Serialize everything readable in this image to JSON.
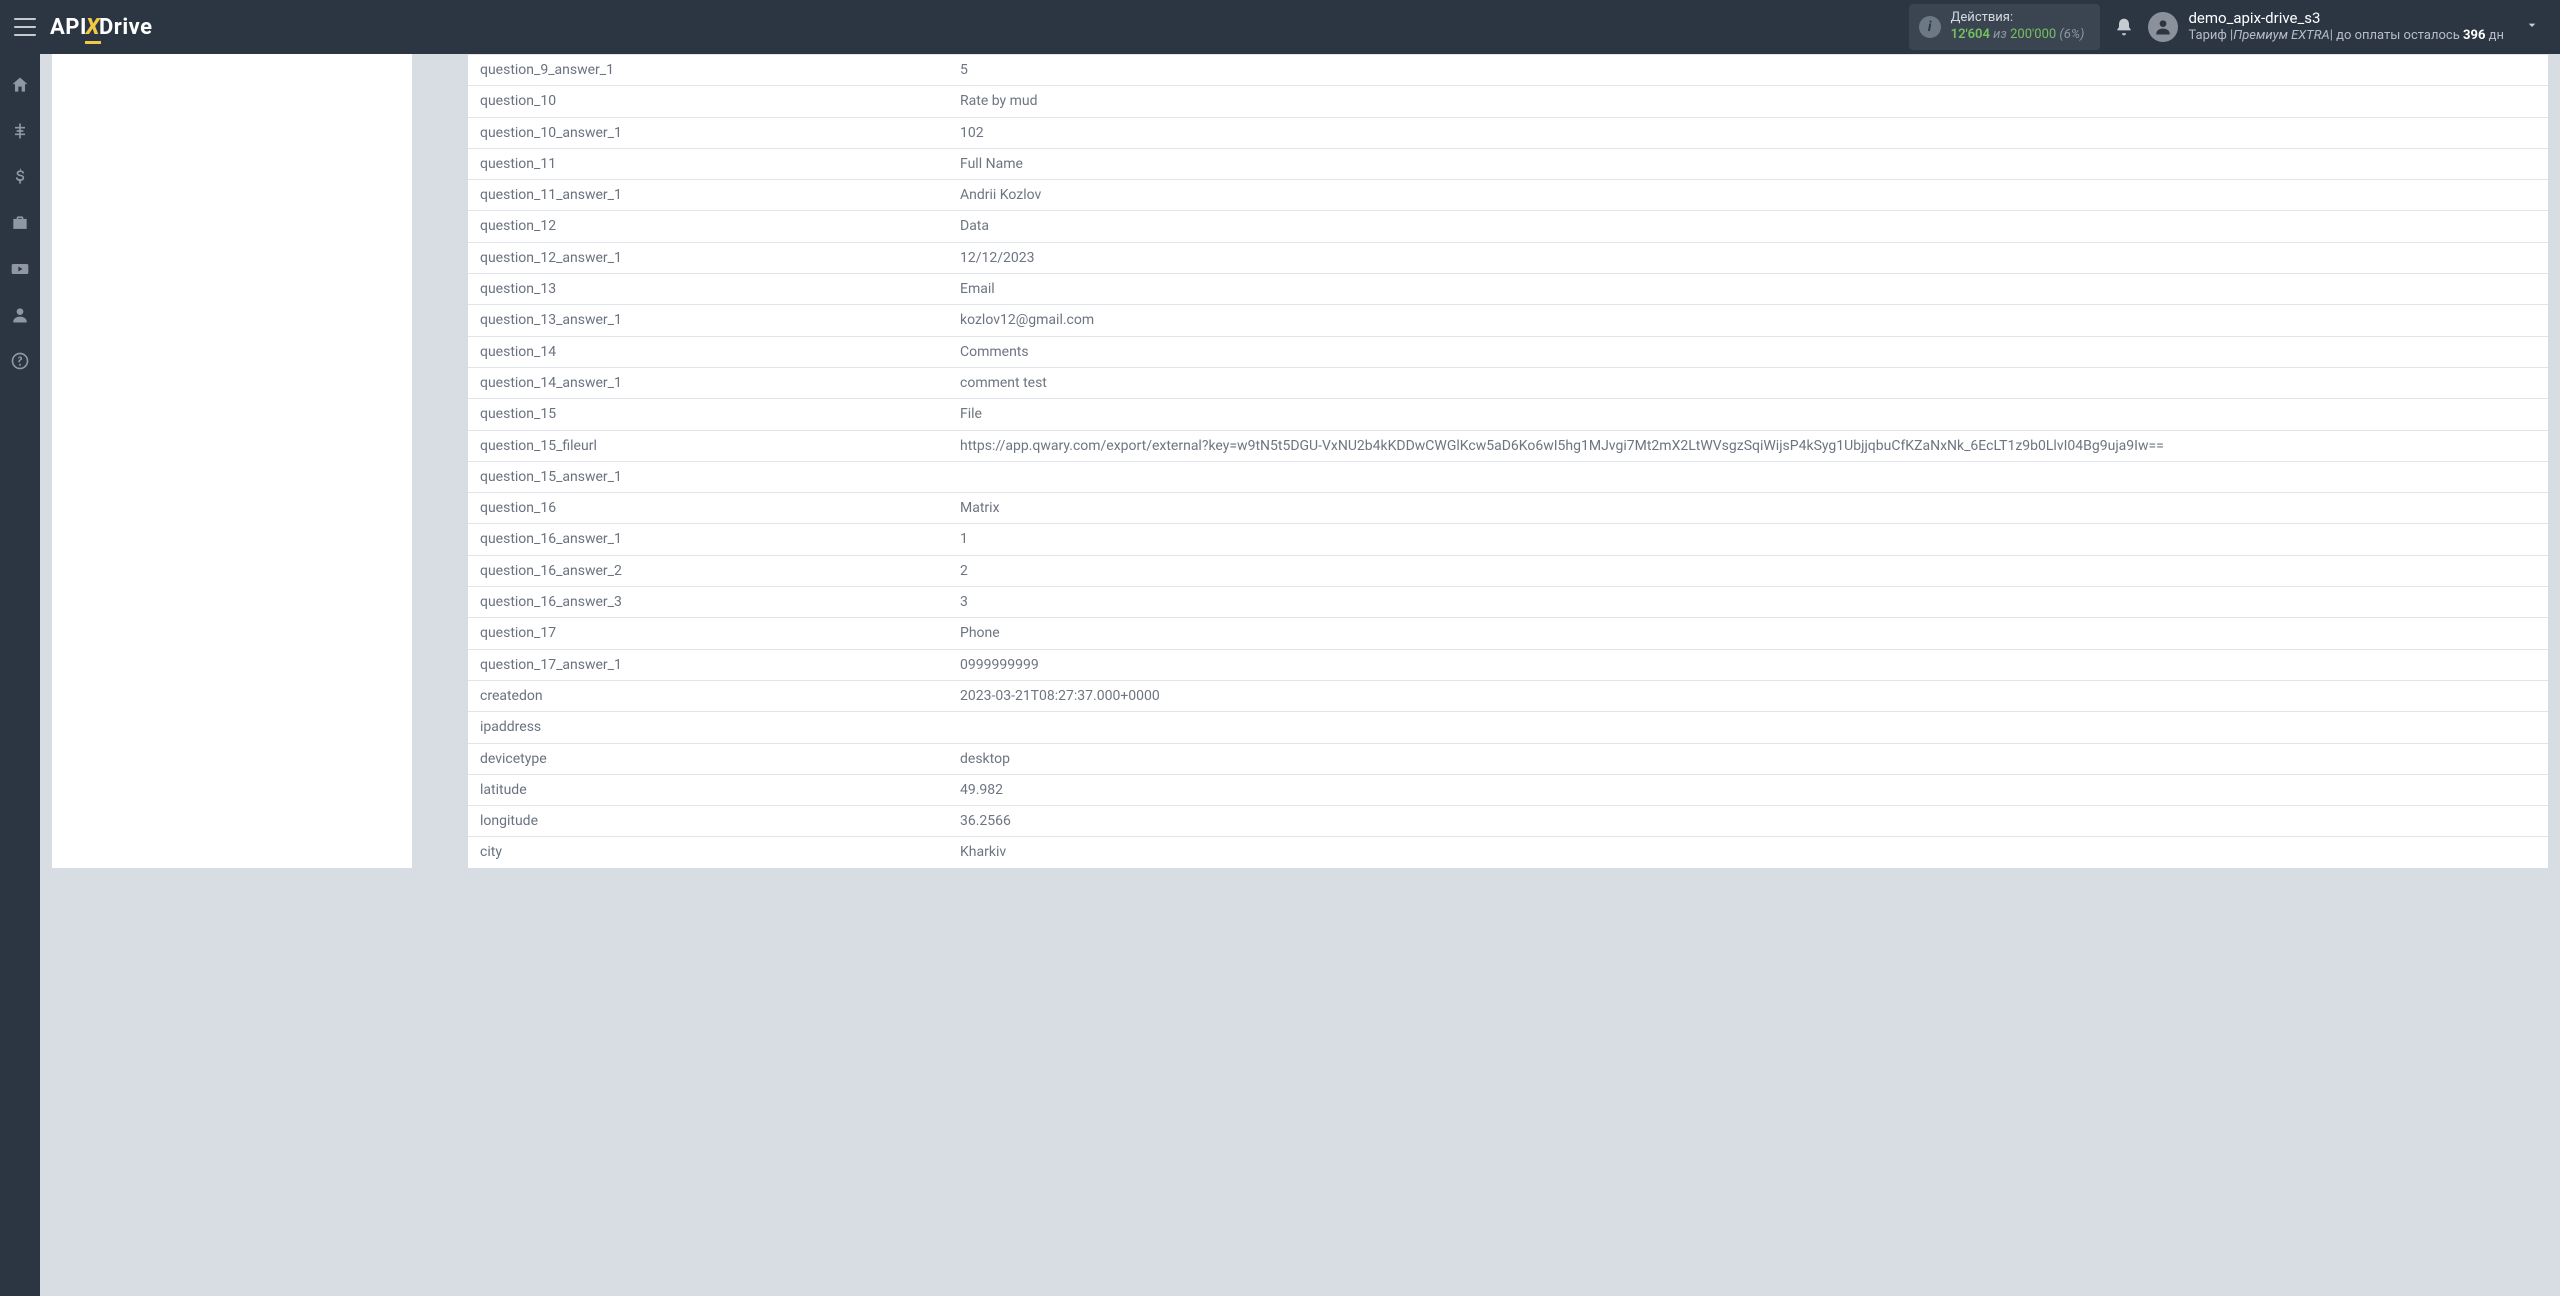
{
  "header": {
    "logo_part1": "API",
    "logo_x": "X",
    "logo_part2": "Drive",
    "actions_label": "Действия:",
    "actions_used": "12'604",
    "actions_iz": "из",
    "actions_total": "200'000",
    "actions_pct": "(6%)",
    "user_name": "demo_apix-drive_s3",
    "user_sub_prefix": "Тариф |",
    "user_sub_plan": "Премиум EXTRA",
    "user_sub_mid": "| до оплаты осталось ",
    "user_sub_days": "396",
    "user_sub_suffix": " дн"
  },
  "sidebar": {
    "items": [
      {
        "name": "home-icon"
      },
      {
        "name": "tree-icon"
      },
      {
        "name": "dollar-icon"
      },
      {
        "name": "briefcase-icon"
      },
      {
        "name": "youtube-icon"
      },
      {
        "name": "user-icon"
      },
      {
        "name": "help-icon"
      }
    ]
  },
  "rows": [
    {
      "key": "question_9_answer_1",
      "val": "5"
    },
    {
      "key": "question_10",
      "val": "Rate by mud"
    },
    {
      "key": "question_10_answer_1",
      "val": "102"
    },
    {
      "key": "question_11",
      "val": "Full Name"
    },
    {
      "key": "question_11_answer_1",
      "val": "Andrii Kozlov"
    },
    {
      "key": "question_12",
      "val": "Data"
    },
    {
      "key": "question_12_answer_1",
      "val": "12/12/2023"
    },
    {
      "key": "question_13",
      "val": "Email"
    },
    {
      "key": "question_13_answer_1",
      "val": "kozlov12@gmail.com"
    },
    {
      "key": "question_14",
      "val": "Comments"
    },
    {
      "key": "question_14_answer_1",
      "val": "comment test"
    },
    {
      "key": "question_15",
      "val": "File"
    },
    {
      "key": "question_15_fileurl",
      "val": "https://app.qwary.com/export/external?key=w9tN5t5DGU-VxNU2b4kKDDwCWGlKcw5aD6Ko6wI5hg1MJvgi7Mt2mX2LtWVsgzSqiWijsP4kSyg1UbjjqbuCfKZaNxNk_6EcLT1z9b0LlvI04Bg9uja9Iw=="
    },
    {
      "key": "question_15_answer_1",
      "val": ""
    },
    {
      "key": "question_16",
      "val": "Matrix"
    },
    {
      "key": "question_16_answer_1",
      "val": "1"
    },
    {
      "key": "question_16_answer_2",
      "val": "2"
    },
    {
      "key": "question_16_answer_3",
      "val": "3"
    },
    {
      "key": "question_17",
      "val": "Phone"
    },
    {
      "key": "question_17_answer_1",
      "val": "0999999999"
    },
    {
      "key": "createdon",
      "val": "2023-03-21T08:27:37.000+0000"
    },
    {
      "key": "ipaddress",
      "val": ""
    },
    {
      "key": "devicetype",
      "val": "desktop"
    },
    {
      "key": "latitude",
      "val": "49.982"
    },
    {
      "key": "longitude",
      "val": "36.2566"
    },
    {
      "key": "city",
      "val": "Kharkiv"
    }
  ]
}
